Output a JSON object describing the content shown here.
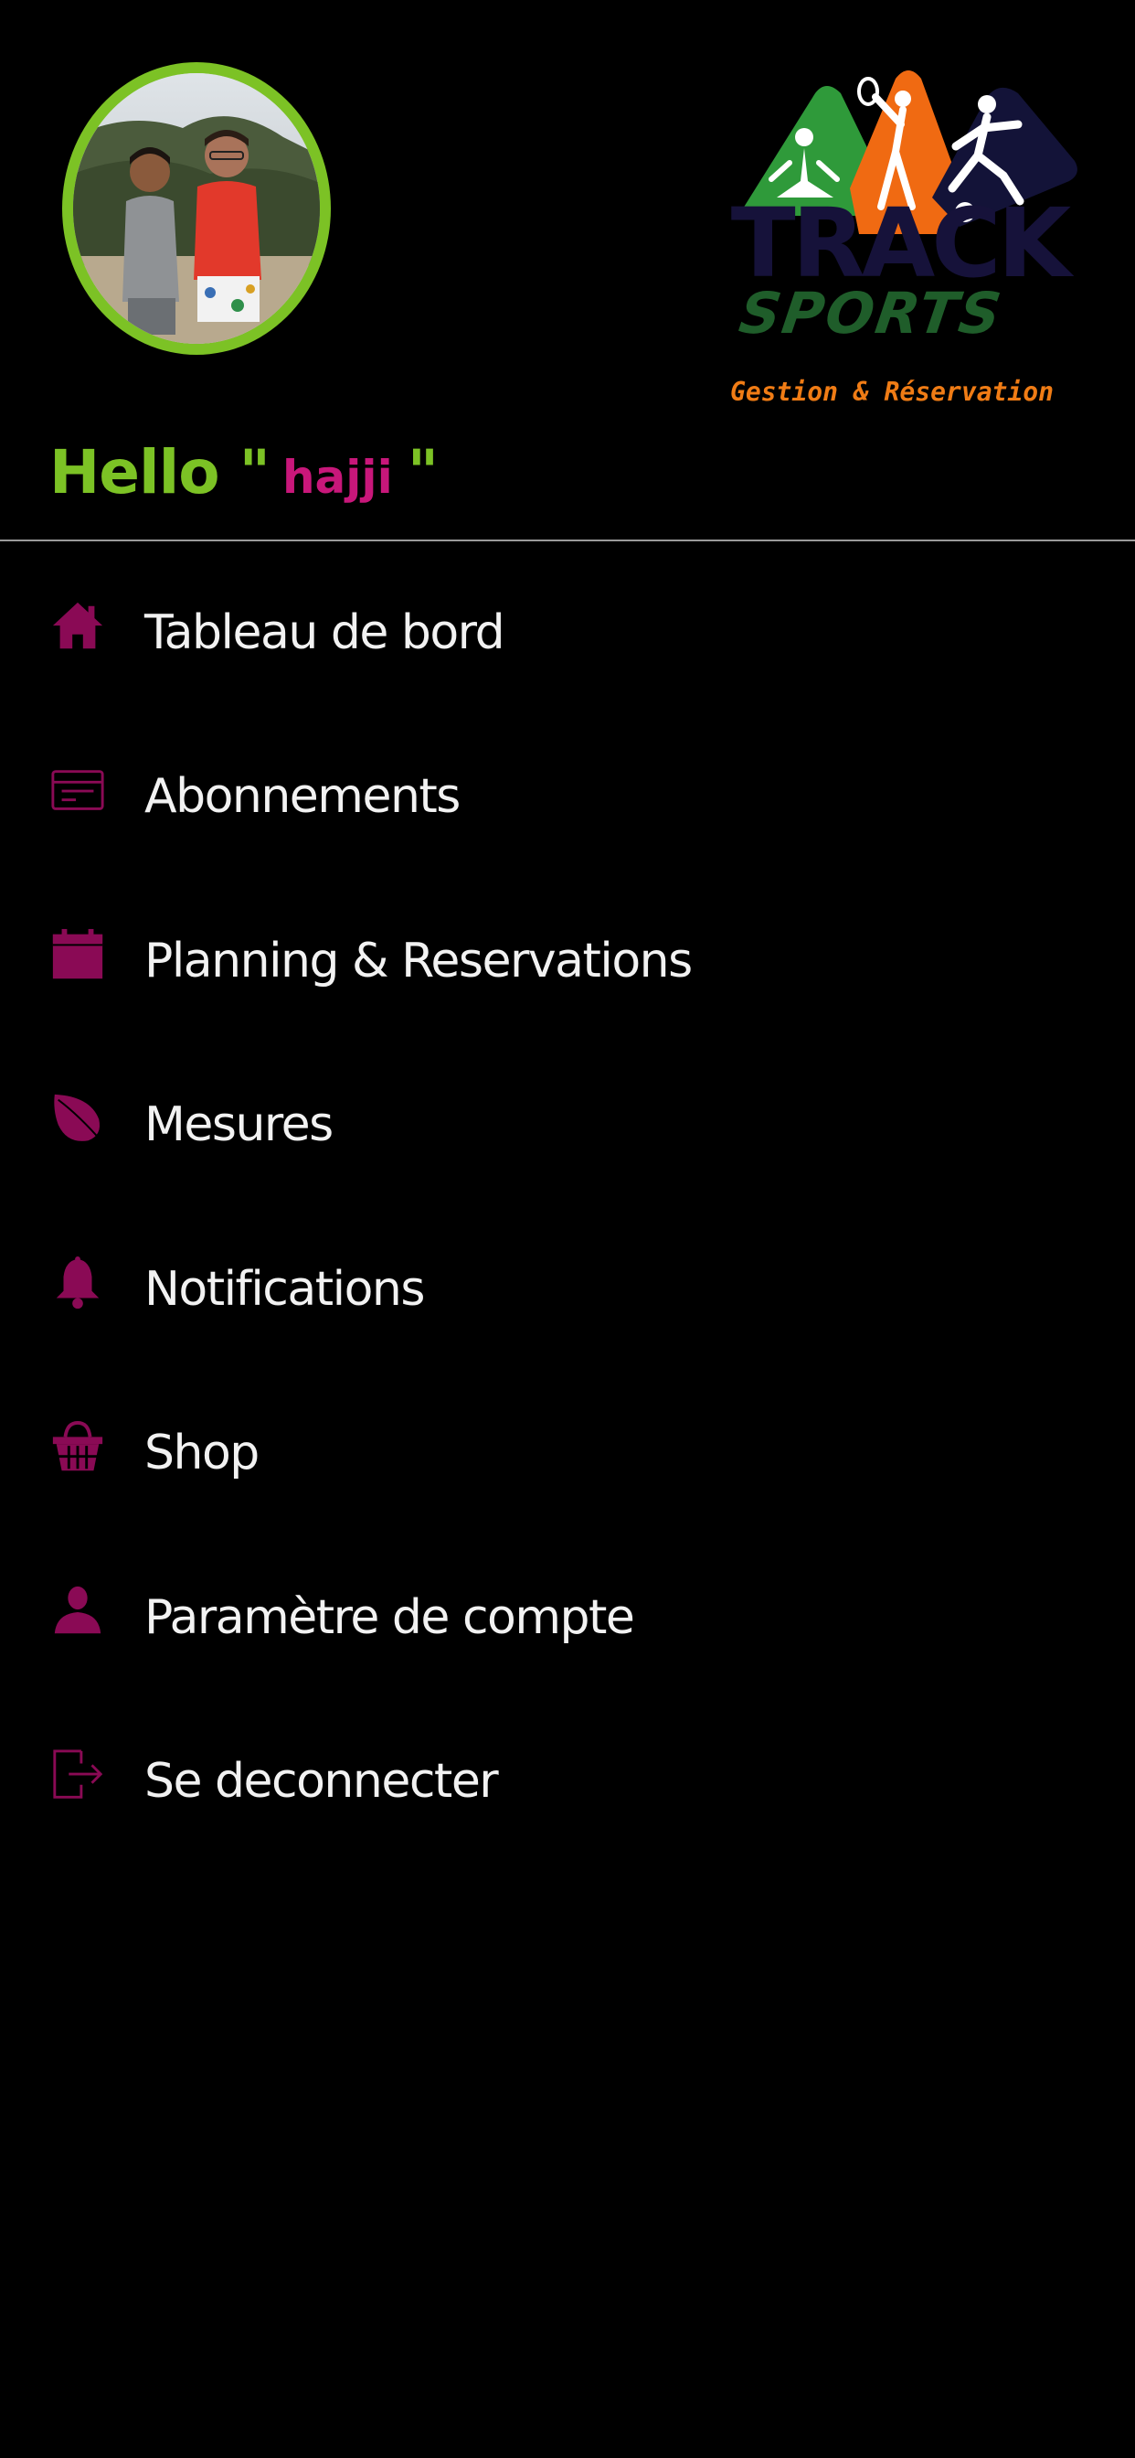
{
  "header": {
    "greeting_prefix": "Hello \"",
    "username": "hajji",
    "greeting_suffix": "\"",
    "logo": {
      "line1": "TRACK",
      "line2": "SPORTS",
      "tagline": "Gestion & Réservation"
    }
  },
  "menu": {
    "items": [
      {
        "label": "Tableau de bord",
        "icon": "home-icon"
      },
      {
        "label": "Abonnements",
        "icon": "card-icon"
      },
      {
        "label": "Planning & Reservations",
        "icon": "calendar-icon"
      },
      {
        "label": "Mesures",
        "icon": "leaf-icon"
      },
      {
        "label": "Notifications",
        "icon": "bell-icon"
      },
      {
        "label": "Shop",
        "icon": "basket-icon"
      },
      {
        "label": "Paramètre de compte",
        "icon": "user-icon"
      },
      {
        "label": "Se deconnecter",
        "icon": "logout-icon"
      }
    ]
  },
  "colors": {
    "background": "#000000",
    "accent_green": "#7cc225",
    "accent_magenta": "#c8177a",
    "icon_color": "#8a0a55",
    "text": "#f2f2f2",
    "divider": "#9a9a9a"
  }
}
